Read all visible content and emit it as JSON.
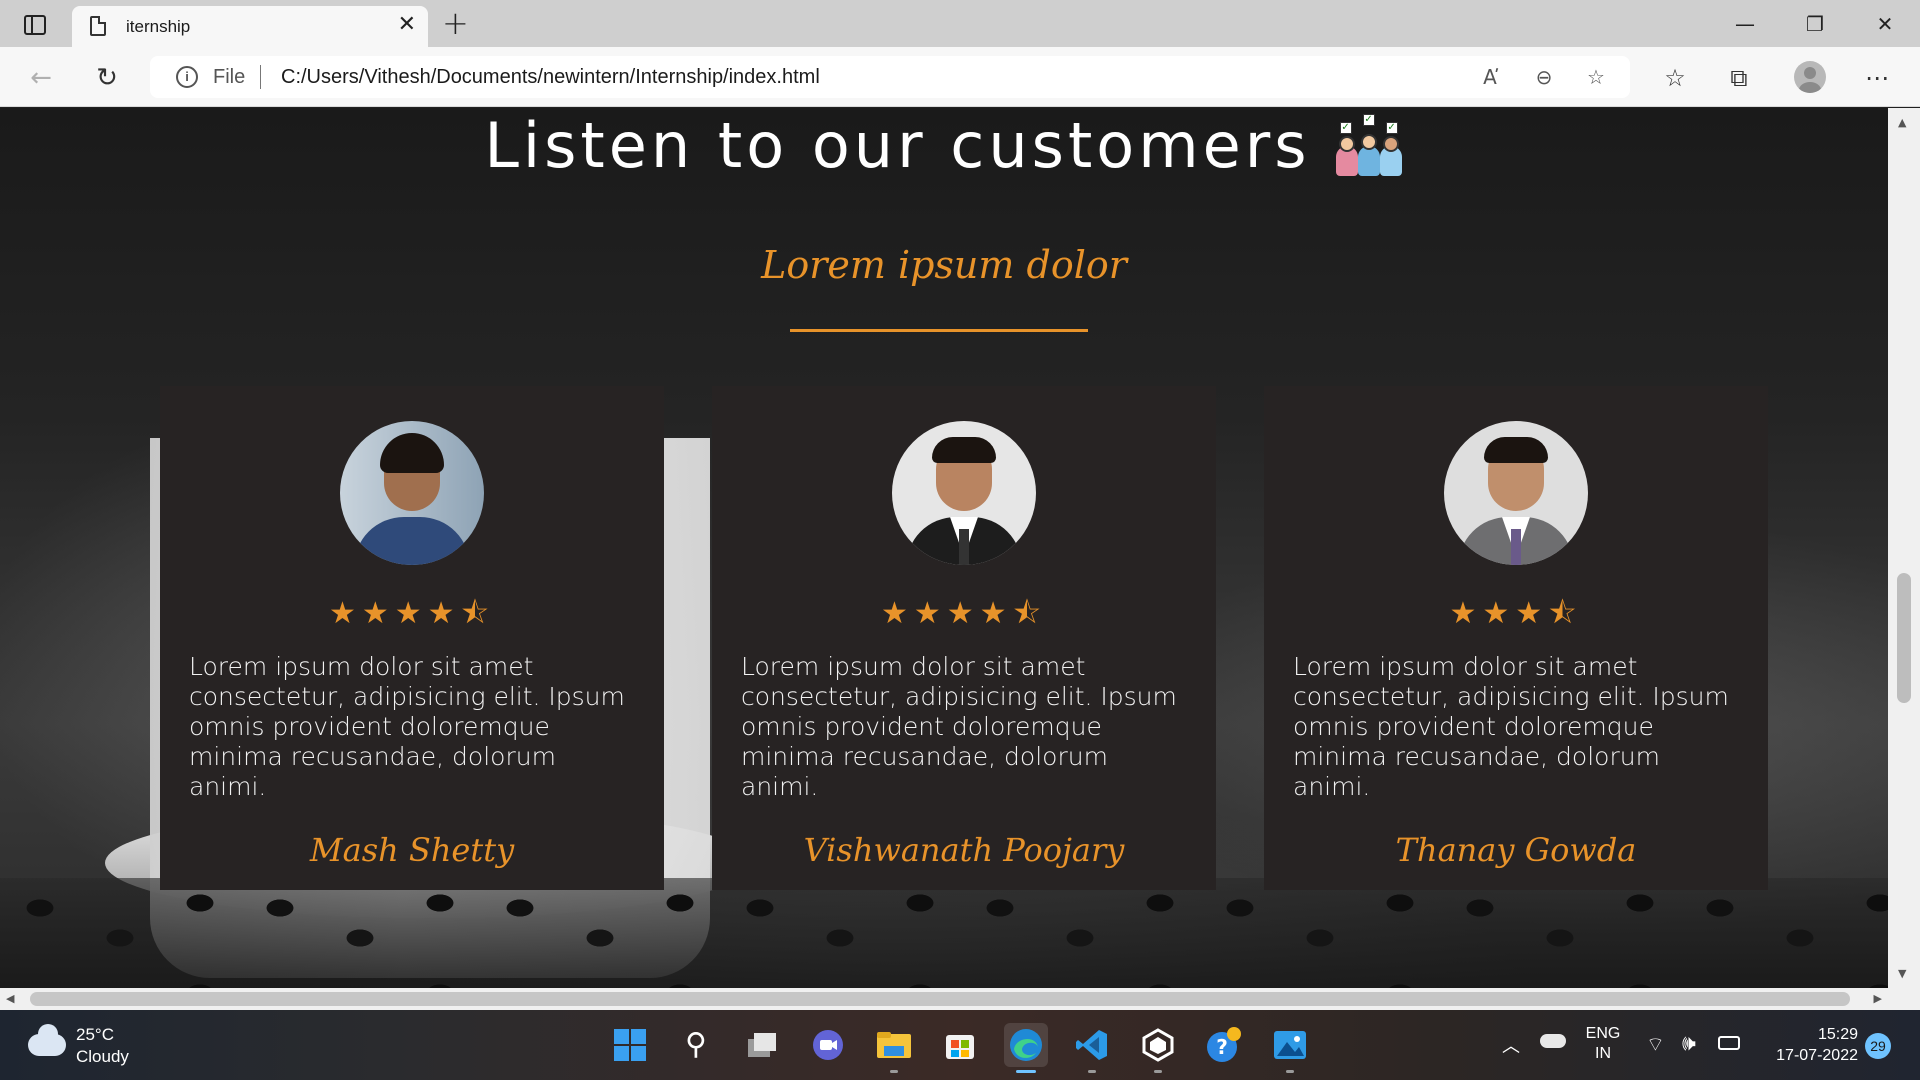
{
  "browser": {
    "tab_title": "iternship",
    "tab_close": "✕",
    "new_tab": "+",
    "address": {
      "scheme_label": "File",
      "url": "C:/Users/Vithesh/Documents/newintern/Internship/index.html"
    },
    "window_controls": {
      "minimize": "—",
      "restore": "❐",
      "close": "✕"
    }
  },
  "page": {
    "heading": "Listen to our customers",
    "subtitle": "Lorem ipsum dolor",
    "accent_color": "#e8932a",
    "testimonials": [
      {
        "name": "Mash Shetty",
        "rating": 4.5,
        "stars": "★★★★⯪",
        "text": "Lorem ipsum dolor sit amet consectetur, adipisicing elit. Ipsum omnis provident doloremque minima recusandae, dolorum animi."
      },
      {
        "name": "Vishwanath Poojary",
        "rating": 4.5,
        "stars": "★★★★⯪",
        "text": "Lorem ipsum dolor sit amet consectetur, adipisicing elit. Ipsum omnis provident doloremque minima recusandae, dolorum animi."
      },
      {
        "name": "Thanay Gowda",
        "rating": 3.5,
        "stars": "★★★⯪",
        "text": "Lorem ipsum dolor sit amet consectetur, adipisicing elit. Ipsum omnis provident doloremque minima recusandae, dolorum animi."
      }
    ]
  },
  "taskbar": {
    "weather": {
      "temperature": "25°C",
      "condition": "Cloudy"
    },
    "language": {
      "line1": "ENG",
      "line2": "IN"
    },
    "clock": {
      "time": "15:29",
      "date": "17-07-2022"
    },
    "notification_count": "29",
    "apps": [
      "start",
      "search",
      "task-view",
      "chat",
      "file-explorer",
      "store",
      "edge",
      "vscode",
      "app-hexagon",
      "get-help",
      "photos"
    ]
  }
}
